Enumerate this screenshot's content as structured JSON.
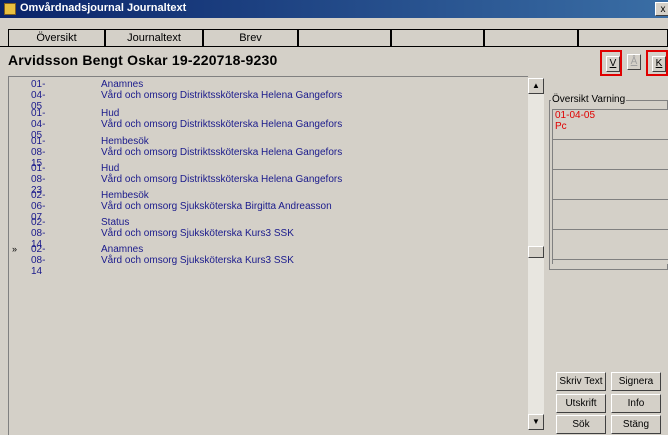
{
  "window": {
    "title": "Omvårdnadsjournal Journaltext",
    "close_label": "x"
  },
  "tabs": [
    {
      "label": "Översikt"
    },
    {
      "label": "Journaltext"
    },
    {
      "label": "Brev"
    },
    {
      "label": ""
    },
    {
      "label": ""
    },
    {
      "label": ""
    },
    {
      "label": ""
    }
  ],
  "patient": {
    "name_id": "Arvidsson Bengt Oskar  19-220718-9230"
  },
  "toolbar": {
    "v_label": "V",
    "a_label": "Å",
    "k_label": "K"
  },
  "journal_entries": [
    {
      "date": "01-04-05",
      "title": "Anamnes",
      "who": "Vård och omsorg Distriktssköterska Helena Gangefors",
      "marker": ""
    },
    {
      "date": "01-04-05",
      "title": "Hud",
      "who": "Vård och omsorg Distriktssköterska Helena Gangefors",
      "marker": ""
    },
    {
      "date": "01-08-15",
      "title": "Hembesök",
      "who": "Vård och omsorg Distriktssköterska Helena Gangefors",
      "marker": ""
    },
    {
      "date": "01-08-23",
      "title": "Hud",
      "who": "Vård och omsorg Distriktssköterska Helena Gangefors",
      "marker": ""
    },
    {
      "date": "02-06-07",
      "title": "Hembesök",
      "who": "Vård och omsorg Sjuksköterska Birgitta Andreasson",
      "marker": ""
    },
    {
      "date": "02-08-14",
      "title": "Status",
      "who": "Vård och omsorg Sjuksköterska Kurs3 SSK",
      "marker": ""
    },
    {
      "date": "02-08-14",
      "title": "Anamnes",
      "who": "Vård och omsorg Sjuksköterska Kurs3 SSK",
      "marker": "»"
    }
  ],
  "warnings": {
    "title": "Översikt Varning",
    "rows": [
      {
        "date": "01-04-05",
        "text": "Pc"
      },
      {
        "date": "",
        "text": ""
      },
      {
        "date": "",
        "text": ""
      },
      {
        "date": "",
        "text": ""
      },
      {
        "date": "",
        "text": ""
      }
    ]
  },
  "buttons": {
    "skriv_text": "Skriv Text",
    "signera": "Signera",
    "utskrift": "Utskrift",
    "info": "Info",
    "sok": "Sök",
    "stang": "Stäng"
  },
  "colors": {
    "entry_text": "#1a1a8c",
    "warning_text": "#e00000",
    "titlebar": "#0a246a"
  }
}
